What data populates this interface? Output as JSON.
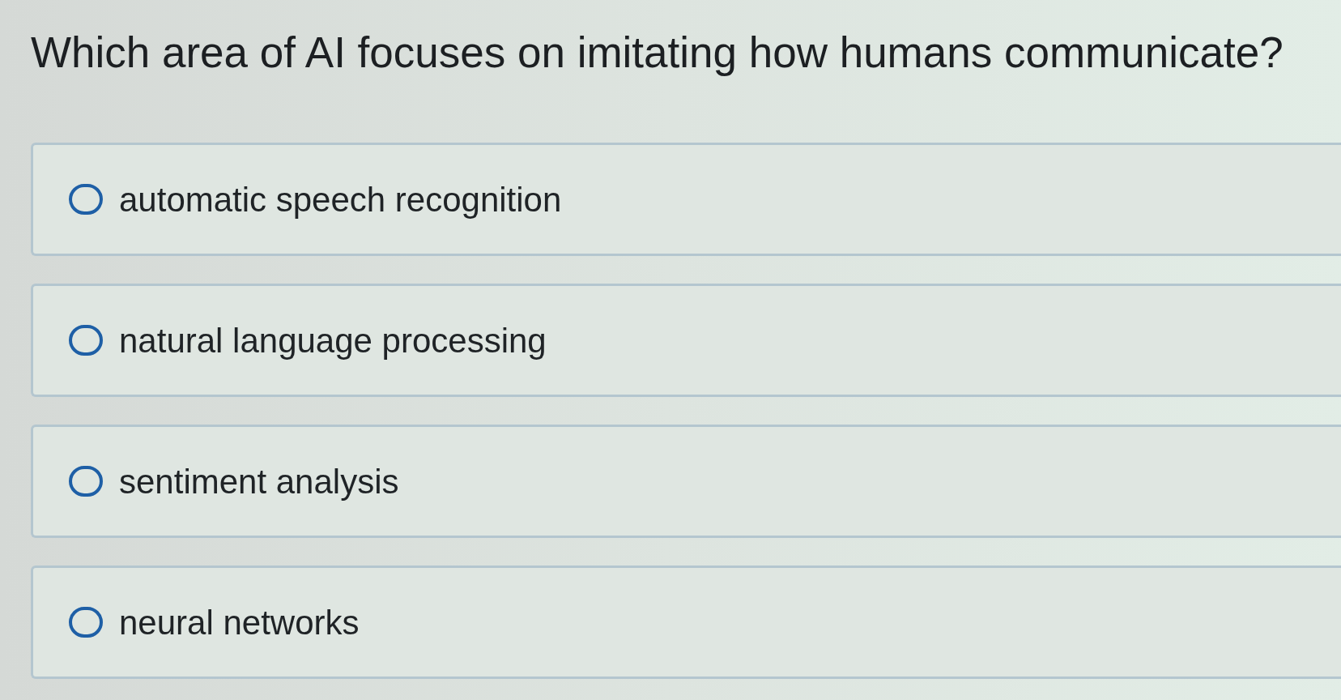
{
  "question": "Which area of AI focuses on imitating how humans communicate?",
  "options": [
    {
      "label": "automatic speech recognition",
      "selected": false
    },
    {
      "label": "natural language processing",
      "selected": false
    },
    {
      "label": "sentiment analysis",
      "selected": false
    },
    {
      "label": "neural networks",
      "selected": false
    }
  ]
}
